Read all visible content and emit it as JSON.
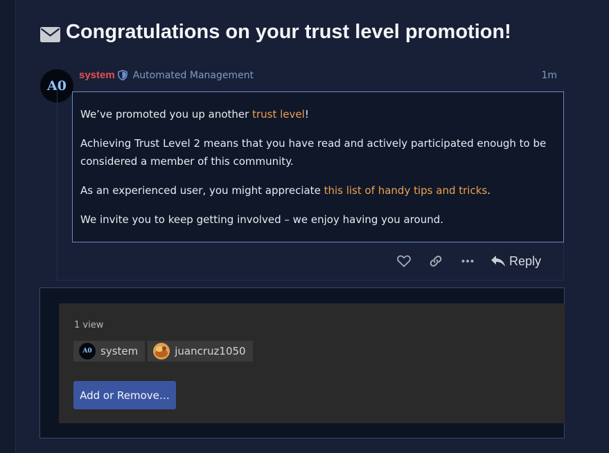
{
  "topic": {
    "title": "Congratulations on your trust level promotion!",
    "title_icon": "envelope-icon"
  },
  "post": {
    "avatar_text": "A0",
    "username": "system",
    "user_flair_icon": "shield-icon",
    "user_title": "Automated Management",
    "date": "1m",
    "body": {
      "p1_before": "We’ve promoted you up another ",
      "p1_link": "trust level",
      "p1_after": "!",
      "p2": "Achieving Trust Level 2 means that you have read and actively participated enough to be considered a member of this community.",
      "p3_before": "As an experienced user, you might appreciate ",
      "p3_link": "this list of handy tips and tricks",
      "p3_after": ".",
      "p4": "We invite you to keep getting involved – we enjoy having you around."
    },
    "actions": {
      "like_icon": "heart-icon",
      "link_icon": "link-icon",
      "more_icon": "ellipsis-icon",
      "reply_label": "Reply"
    }
  },
  "whos_viewed": {
    "count_label": "1 view",
    "users": [
      {
        "name": "system",
        "avatar_text": "A0"
      },
      {
        "name": "juancruz1050"
      }
    ],
    "add_remove_label": "Add or Remove…"
  },
  "colors": {
    "background": "#172036",
    "username": "#e45050",
    "link": "#f0a04e",
    "button": "#3b55a0"
  }
}
